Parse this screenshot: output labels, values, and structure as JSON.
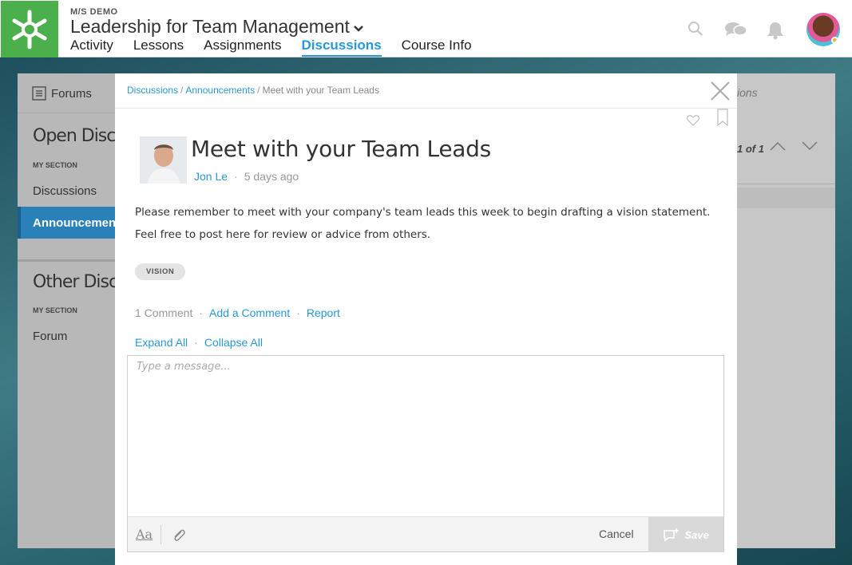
{
  "header": {
    "org": "M/S DEMO",
    "course_title": "Leadership for Team Management",
    "nav": [
      "Activity",
      "Lessons",
      "Assignments",
      "Discussions",
      "Course Info"
    ],
    "active_nav": "Discussions",
    "icons": [
      "search-icon",
      "messages-icon",
      "bell-icon"
    ]
  },
  "sidebar": {
    "forums_label": "Forums",
    "open_section": "Open Discussions",
    "open_sub": "MY SECTION",
    "open_items": [
      "Discussions",
      "Announcements"
    ],
    "selected": "Announcements",
    "other_section": "Other Discussions",
    "other_sub": "MY SECTION",
    "other_items": [
      "Forum"
    ]
  },
  "background_page": {
    "right_label": "ions",
    "pagination_current": "1",
    "pagination_of": "of",
    "pagination_total": "1"
  },
  "modal": {
    "breadcrumb": [
      "Discussions",
      "Announcements",
      "Meet with your Team Leads"
    ],
    "title": "Meet with your Team Leads",
    "author": "Jon Le",
    "time": "5 days ago",
    "body": "Please remember to meet with your company's team leads this week to begin drafting a vision statement. Feel free to post here for review or advice from others.",
    "tag": "VISION",
    "actions": {
      "comments": "1 Comment",
      "add_comment": "Add a Comment",
      "report": "Report"
    },
    "expand_all": "Expand All",
    "collapse_all": "Collapse All",
    "editor": {
      "placeholder": "Type a message...",
      "format_label": "Aa",
      "cancel": "Cancel",
      "save": "Save"
    }
  },
  "colors": {
    "accent": "#2a98d6",
    "logo_green": "#4bb04b",
    "selected_item": "#2a80b9"
  }
}
